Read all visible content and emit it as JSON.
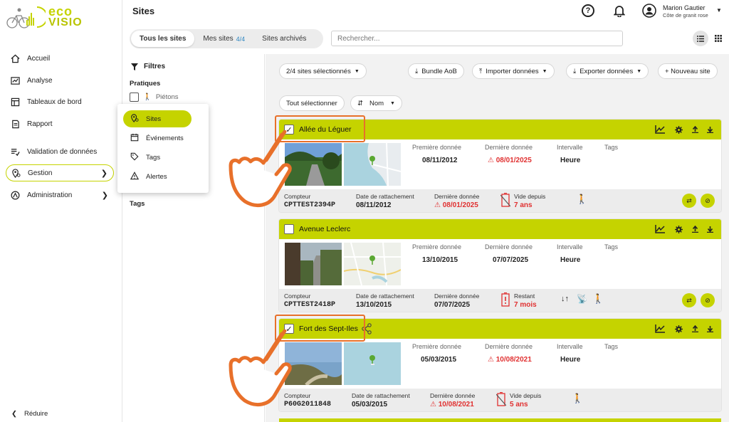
{
  "brand": {
    "line1": "eco",
    "line2": "VISIO",
    "color": "#c5d300"
  },
  "nav": {
    "items": [
      {
        "label": "Accueil",
        "icon": "home-icon"
      },
      {
        "label": "Analyse",
        "icon": "analysis-icon"
      },
      {
        "label": "Tableaux de bord",
        "icon": "dashboard-icon"
      },
      {
        "label": "Rapport",
        "icon": "report-icon"
      },
      {
        "label": "Validation de données",
        "icon": "validation-icon"
      },
      {
        "label": "Gestion",
        "icon": "location-pin-icon"
      },
      {
        "label": "Administration",
        "icon": "admin-icon"
      }
    ],
    "reduce": "Réduire"
  },
  "header": {
    "title": "Sites",
    "user_name": "Marion Gautier",
    "user_org": "Côte de granit rose"
  },
  "tabs": [
    {
      "label": "Tous les sites"
    },
    {
      "label": "Mes sites",
      "count": "4/4"
    },
    {
      "label": "Sites archivés"
    }
  ],
  "search": {
    "placeholder": "Rechercher..."
  },
  "filters": {
    "title": "Filtres",
    "section_pratiques": "Pratiques",
    "option_pietons": "Piétons",
    "section_tags": "Tags"
  },
  "popup": {
    "items": [
      {
        "label": "Sites",
        "icon": "pin-icon"
      },
      {
        "label": "Événements",
        "icon": "calendar-icon"
      },
      {
        "label": "Tags",
        "icon": "tag-icon"
      },
      {
        "label": "Alertes",
        "icon": "warning-icon"
      }
    ]
  },
  "toolbar": {
    "selection": "2/4 sites sélectionnés",
    "bundle": "Bundle AoB",
    "import": "Importer données",
    "export": "Exporter données",
    "new_site": "+ Nouveau site",
    "select_all": "Tout sélectionner",
    "sort": "Nom"
  },
  "labels": {
    "first": "Première donnée",
    "last": "Dernière donnée",
    "interval": "Intervalle",
    "tags": "Tags",
    "counter": "Compteur",
    "attach": "Date de rattachement"
  },
  "sites": [
    {
      "name": "Allée du Léguer",
      "checked": true,
      "first": "08/11/2012",
      "last": "08/01/2025",
      "interval": "Heure",
      "counter": "CPTTEST2394P",
      "attach": "08/11/2012",
      "last_foot": "08/01/2025",
      "status_label": "Vide depuis",
      "status_value": "7 ans"
    },
    {
      "name": "Avenue Leclerc",
      "checked": false,
      "first": "13/10/2015",
      "last": "07/07/2025",
      "interval": "Heure",
      "counter": "CPTTEST2418P",
      "attach": "13/10/2015",
      "last_foot": "07/07/2025",
      "status_label": "Restant",
      "status_value": "7 mois"
    },
    {
      "name": "Fort des Sept-Iles",
      "checked": true,
      "first": "05/03/2015",
      "last": "10/08/2021",
      "interval": "Heure",
      "counter": "P60G2011848",
      "attach": "05/03/2015",
      "last_foot": "10/08/2021",
      "status_label": "Vide depuis",
      "status_value": "5 ans"
    }
  ],
  "colors": {
    "accent": "#c5d300",
    "alert": "#e03030",
    "highlight": "#e8702a"
  }
}
